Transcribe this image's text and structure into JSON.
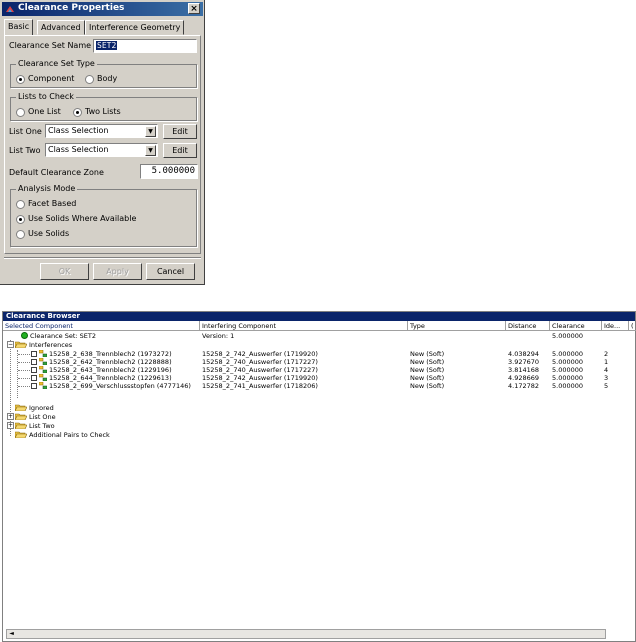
{
  "dialog": {
    "title": "Clearance Properties",
    "close_glyph": "×",
    "tabs": [
      "Basic",
      "Advanced",
      "Interference Geometry"
    ],
    "clearance_set_name": {
      "label": "Clearance Set Name",
      "value": "SET2"
    },
    "clearance_set_type": {
      "title": "Clearance Set Type",
      "options": [
        "Component",
        "Body"
      ],
      "selected": "Component"
    },
    "lists_to_check": {
      "title": "Lists to Check",
      "options": [
        "One List",
        "Two Lists"
      ],
      "selected": "Two Lists"
    },
    "list_one": {
      "label": "List One",
      "value": "Class Selection",
      "edit": "Edit"
    },
    "list_two": {
      "label": "List Two",
      "value": "Class Selection",
      "edit": "Edit"
    },
    "default_zone": {
      "label": "Default Clearance Zone",
      "value": "5.000000"
    },
    "analysis_mode": {
      "title": "Analysis Mode",
      "options": [
        "Facet Based",
        "Use Solids Where Available",
        "Use Solids"
      ],
      "selected": "Use Solids Where Available"
    },
    "buttons": {
      "ok": "OK",
      "apply": "Apply",
      "cancel": "Cancel"
    }
  },
  "browser": {
    "title": "Clearance Browser",
    "columns": [
      "Selected Component",
      "Interfering Component",
      "Type",
      "Distance",
      "Clearance",
      "Ide...",
      "("
    ],
    "root": {
      "label": "Clearance Set: SET2",
      "interfering": "Version: 1",
      "clearance": "5.000000"
    },
    "interferences_label": "Interferences",
    "rows": [
      {
        "selected": "15258_2_638_Trennblech2 (1973272)",
        "interfering": "15258_2_742_Auswerfer (1719920)",
        "type": "New (Soft)",
        "distance": "4.038294",
        "clearance": "5.000000",
        "id": "2"
      },
      {
        "selected": "15258_2_642_Trennblech2 (1228888)",
        "interfering": "15258_2_740_Auswerfer (1717227)",
        "type": "New (Soft)",
        "distance": "3.927670",
        "clearance": "5.000000",
        "id": "1"
      },
      {
        "selected": "15258_2_643_Trennblech2 (1229196)",
        "interfering": "15258_2_740_Auswerfer (1717227)",
        "type": "New (Soft)",
        "distance": "3.814168",
        "clearance": "5.000000",
        "id": "4"
      },
      {
        "selected": "15258_2_644_Trennblech2 (1229613)",
        "interfering": "15258_2_742_Auswerfer (1719920)",
        "type": "New (Soft)",
        "distance": "4.928669",
        "clearance": "5.000000",
        "id": "3"
      },
      {
        "selected": "15258_2_699_Verschlussstopfen (4777146)",
        "interfering": "15258_2_741_Auswerfer (1718206)",
        "type": "New (Soft)",
        "distance": "4.172782",
        "clearance": "5.000000",
        "id": "5"
      }
    ],
    "ignored_label": "Ignored",
    "list_one_label": "List One",
    "list_two_label": "List Two",
    "additional_label": "Additional Pairs to Check",
    "scroll_left_glyph": "◄"
  },
  "colors": {
    "title_active": "#0a246a",
    "face": "#d4d0c8",
    "status_green": "#22b022",
    "folder": "#e8c040"
  }
}
